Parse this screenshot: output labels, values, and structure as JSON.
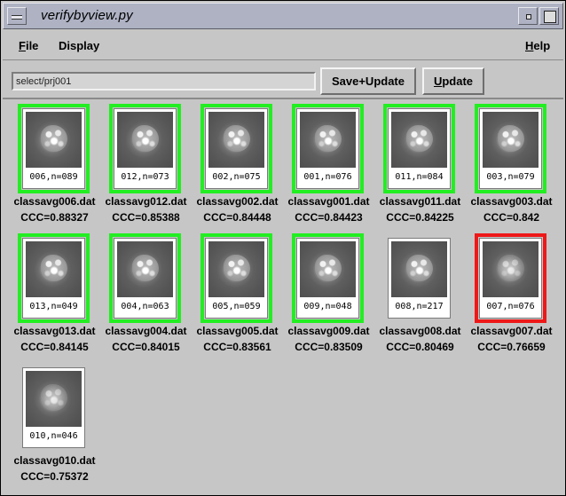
{
  "window": {
    "title": "verifybyview.py"
  },
  "menubar": {
    "file": "File",
    "display": "Display",
    "help": "Help"
  },
  "toolbar": {
    "path_value": "select/prj001",
    "save_update_label": "Save+Update",
    "update_label": "Update"
  },
  "colors": {
    "good": "#22ee22",
    "bad": "#ee1818"
  },
  "images": [
    {
      "tag": "006,n=089",
      "file": "classavg006.dat",
      "ccc": "CCC=0.88327",
      "status": "good"
    },
    {
      "tag": "012,n=073",
      "file": "classavg012.dat",
      "ccc": "CCC=0.85388",
      "status": "good"
    },
    {
      "tag": "002,n=075",
      "file": "classavg002.dat",
      "ccc": "CCC=0.84448",
      "status": "good"
    },
    {
      "tag": "001,n=076",
      "file": "classavg001.dat",
      "ccc": "CCC=0.84423",
      "status": "good"
    },
    {
      "tag": "011,n=084",
      "file": "classavg011.dat",
      "ccc": "CCC=0.84225",
      "status": "good"
    },
    {
      "tag": "003,n=079",
      "file": "classavg003.dat",
      "ccc": "CCC=0.842",
      "status": "good"
    },
    {
      "tag": "013,n=049",
      "file": "classavg013.dat",
      "ccc": "CCC=0.84145",
      "status": "good"
    },
    {
      "tag": "004,n=063",
      "file": "classavg004.dat",
      "ccc": "CCC=0.84015",
      "status": "good"
    },
    {
      "tag": "005,n=059",
      "file": "classavg005.dat",
      "ccc": "CCC=0.83561",
      "status": "good"
    },
    {
      "tag": "009,n=048",
      "file": "classavg009.dat",
      "ccc": "CCC=0.83509",
      "status": "good"
    },
    {
      "tag": "008,n=217",
      "file": "classavg008.dat",
      "ccc": "CCC=0.80469",
      "status": "none"
    },
    {
      "tag": "007,n=076",
      "file": "classavg007.dat",
      "ccc": "CCC=0.76659",
      "status": "bad"
    },
    {
      "tag": "010,n=046",
      "file": "classavg010.dat",
      "ccc": "CCC=0.75372",
      "status": "none"
    }
  ]
}
